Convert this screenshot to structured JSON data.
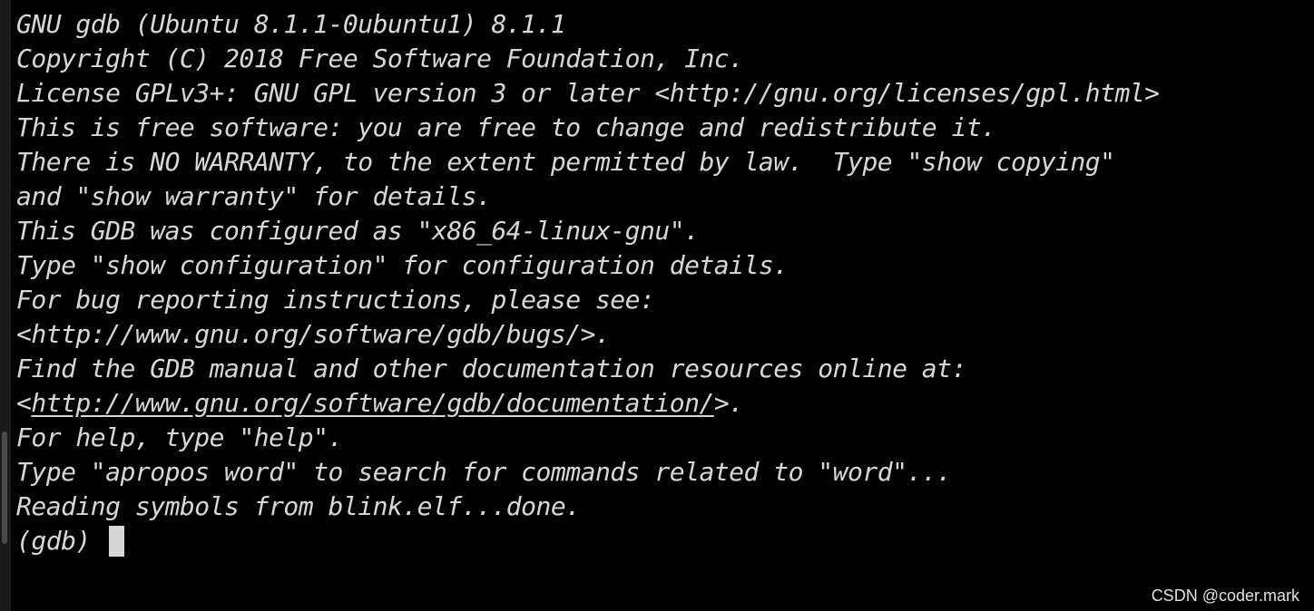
{
  "terminal": {
    "lines": [
      "GNU gdb (Ubuntu 8.1.1-0ubuntu1) 8.1.1",
      "Copyright (C) 2018 Free Software Foundation, Inc.",
      "License GPLv3+: GNU GPL version 3 or later <http://gnu.org/licenses/gpl.html>",
      "This is free software: you are free to change and redistribute it.",
      "There is NO WARRANTY, to the extent permitted by law.  Type \"show copying\"",
      "and \"show warranty\" for details.",
      "This GDB was configured as \"x86_64-linux-gnu\".",
      "Type \"show configuration\" for configuration details.",
      "For bug reporting instructions, please see:",
      "<http://www.gnu.org/software/gdb/bugs/>.",
      "Find the GDB manual and other documentation resources online at:"
    ],
    "doc_link": {
      "prefix": "<",
      "url": "http://www.gnu.org/software/gdb/documentation/",
      "suffix": ">."
    },
    "lines_after": [
      "For help, type \"help\".",
      "Type \"apropos word\" to search for commands related to \"word\"...",
      "Reading symbols from blink.elf...done."
    ],
    "prompt": "(gdb) "
  },
  "watermark": "CSDN @coder.mark"
}
